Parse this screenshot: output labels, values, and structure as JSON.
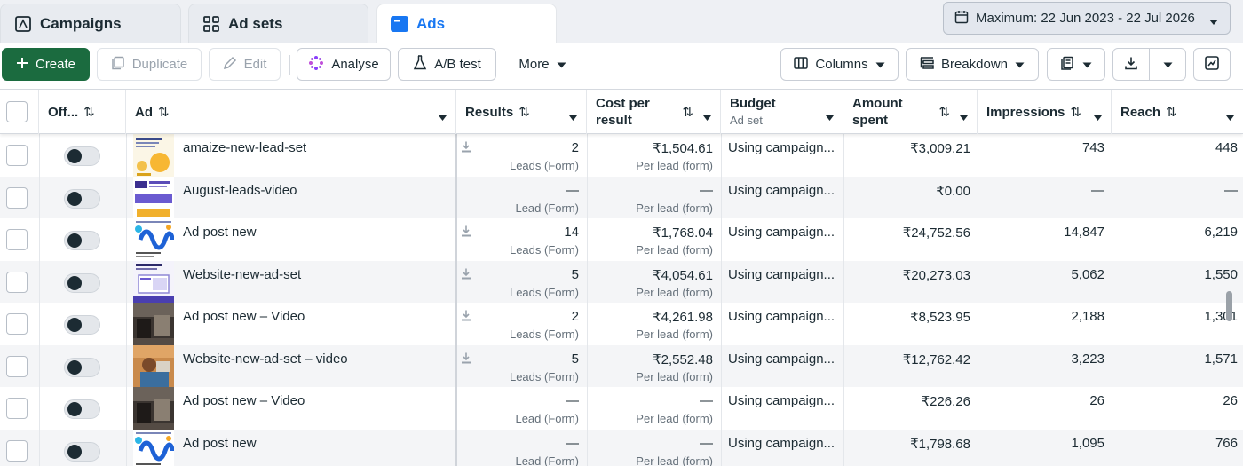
{
  "tabs": [
    {
      "label": "Campaigns",
      "icon": "campaign-flag-icon"
    },
    {
      "label": "Ad sets",
      "icon": "grid-icon"
    },
    {
      "label": "Ads",
      "icon": "ad-icon",
      "active": true
    }
  ],
  "date_range": {
    "label": "Maximum: 22 Jun 2023 - 22 Jul 2026"
  },
  "toolbar": {
    "create": "Create",
    "duplicate": "Duplicate",
    "edit": "Edit",
    "analyse": "Analyse",
    "ab_test": "A/B test",
    "more": "More",
    "columns": "Columns",
    "breakdown": "Breakdown"
  },
  "headers": {
    "off": "Off...",
    "ad": "Ad",
    "results": "Results",
    "cost_line1": "Cost per",
    "cost_line2": "result",
    "budget": "Budget",
    "budget_sub": "Ad set",
    "amount_line1": "Amount",
    "amount_line2": "spent",
    "impressions": "Impressions",
    "reach": "Reach"
  },
  "rows": [
    {
      "name": "amaize-new-lead-set",
      "download": true,
      "results": "2",
      "results_sub": "Leads (Form)",
      "cost": "₹1,504.61",
      "cost_sub": "Per lead (form)",
      "budget": "Using campaign...",
      "amount": "₹3,009.21",
      "impressions": "743",
      "reach": "448",
      "thumb": "yellow"
    },
    {
      "name": "August-leads-video",
      "download": false,
      "results": "—",
      "results_sub": "Lead (Form)",
      "cost": "—",
      "cost_sub": "Per lead (form)",
      "budget": "Using campaign...",
      "amount": "₹0.00",
      "impressions": "—",
      "reach": "—",
      "thumb": "purple"
    },
    {
      "name": "Ad post new",
      "download": true,
      "results": "14",
      "results_sub": "Leads (Form)",
      "cost": "₹1,768.04",
      "cost_sub": "Per lead (form)",
      "budget": "Using campaign...",
      "amount": "₹24,752.56",
      "impressions": "14,847",
      "reach": "6,219",
      "thumb": "blue"
    },
    {
      "name": "Website-new-ad-set",
      "download": true,
      "results": "5",
      "results_sub": "Leads (Form)",
      "cost": "₹4,054.61",
      "cost_sub": "Per lead (form)",
      "budget": "Using campaign...",
      "amount": "₹20,273.03",
      "impressions": "5,062",
      "reach": "1,550",
      "thumb": "site"
    },
    {
      "name": "Ad post new – Video",
      "download": true,
      "results": "2",
      "results_sub": "Leads (Form)",
      "cost": "₹4,261.98",
      "cost_sub": "Per lead (form)",
      "budget": "Using campaign...",
      "amount": "₹8,523.95",
      "impressions": "2,188",
      "reach": "1,301",
      "thumb": "photo"
    },
    {
      "name": "Website-new-ad-set – video",
      "download": true,
      "results": "5",
      "results_sub": "Leads (Form)",
      "cost": "₹2,552.48",
      "cost_sub": "Per lead (form)",
      "budget": "Using campaign...",
      "amount": "₹12,762.42",
      "impressions": "3,223",
      "reach": "1,571",
      "thumb": "person"
    },
    {
      "name": "Ad post new – Video",
      "download": false,
      "results": "—",
      "results_sub": "Lead (Form)",
      "cost": "—",
      "cost_sub": "Per lead (form)",
      "budget": "Using campaign...",
      "amount": "₹226.26",
      "impressions": "26",
      "reach": "26",
      "thumb": "photo"
    },
    {
      "name": "Ad post new",
      "download": false,
      "results": "—",
      "results_sub": "Lead (Form)",
      "cost": "—",
      "cost_sub": "Per lead (form)",
      "budget": "Using campaign...",
      "amount": "₹1,798.68",
      "impressions": "1,095",
      "reach": "766",
      "thumb": "blue"
    }
  ],
  "colors": {
    "accent": "#1877f2",
    "create_green": "#1b6b3f"
  }
}
